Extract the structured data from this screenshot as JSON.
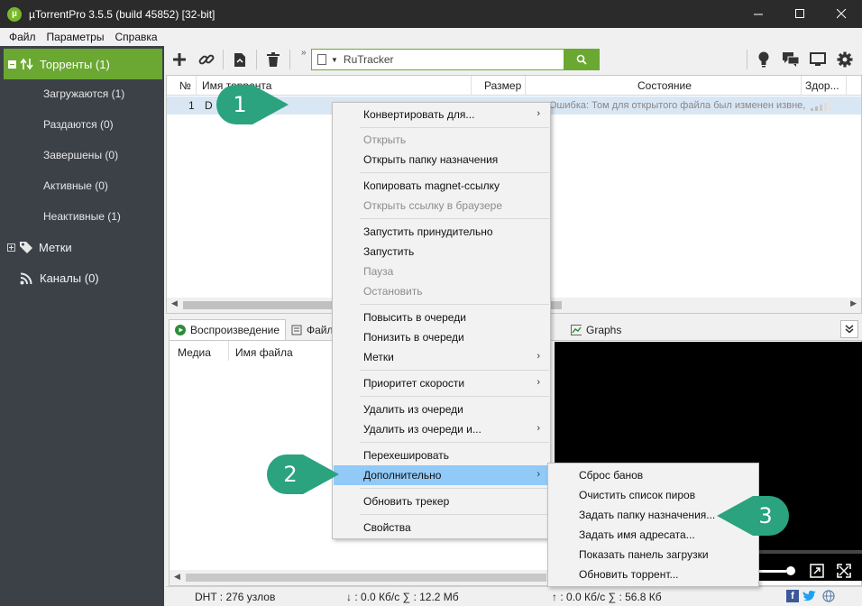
{
  "window": {
    "title": "µTorrentPro 3.5.5  (build 45852) [32-bit]",
    "app_icon_glyph": "µ"
  },
  "menubar": [
    "Файл",
    "Параметры",
    "Справка"
  ],
  "sidebar": {
    "root": "Торренты (1)",
    "items": [
      "Загружаются (1)",
      "Раздаются (0)",
      "Завершены (0)",
      "Активные (0)",
      "Неактивные (1)"
    ],
    "labels": "Метки",
    "feeds": "Каналы (0)"
  },
  "toolbar": {
    "search_value": "RuTracker",
    "icons_left": [
      "add-icon",
      "link-icon",
      "create-icon",
      "delete-icon"
    ],
    "icons_right": [
      "bulb-icon",
      "chat-icon",
      "monitor-icon",
      "gear-icon"
    ]
  },
  "list": {
    "columns": [
      "№",
      "Имя торрента",
      "Размер",
      "Состояние",
      "Здор..."
    ],
    "row": {
      "num": "1",
      "name": "D",
      "status": "Ошибка: Том для открытого файла был изменен извне,"
    }
  },
  "tabs": [
    "Воспроизведение",
    "Файлы",
    "Graphs"
  ],
  "playback": {
    "col_media": "Медиа",
    "col_file": "Имя файла"
  },
  "status": {
    "dht": "DHT : 276 узлов",
    "down": "↓ : 0.0 Кб/с  ∑ : 12.2 Мб",
    "up": "↑ : 0.0 Кб/с  ∑ : 56.8 Кб"
  },
  "context_menu": [
    {
      "label": "Конвертировать для...",
      "submenu": true,
      "disabled": false
    },
    {
      "label": "Открыть",
      "disabled": true
    },
    {
      "label": "Открыть папку назначения",
      "disabled": false
    },
    {
      "label": "Копировать magnet-ссылку",
      "disabled": false
    },
    {
      "label": "Открыть ссылку в браузере",
      "disabled": true
    },
    {
      "label": "Запустить принудительно",
      "disabled": false
    },
    {
      "label": "Запустить",
      "disabled": false
    },
    {
      "label": "Пауза",
      "disabled": true
    },
    {
      "label": "Остановить",
      "disabled": true
    },
    {
      "label": "Повысить в очереди",
      "disabled": false
    },
    {
      "label": "Понизить в очереди",
      "disabled": false
    },
    {
      "label": "Метки",
      "submenu": true,
      "disabled": false
    },
    {
      "label": "Приоритет скорости",
      "submenu": true,
      "disabled": false
    },
    {
      "label": "Удалить из очереди",
      "disabled": false
    },
    {
      "label": "Удалить из очереди и...",
      "submenu": true,
      "disabled": false
    },
    {
      "label": "Перехешировать",
      "disabled": false
    },
    {
      "label": "Дополнительно",
      "submenu": true,
      "disabled": false,
      "highlighted": true
    },
    {
      "label": "Обновить трекер",
      "disabled": false
    },
    {
      "label": "Свойства",
      "disabled": false
    }
  ],
  "submenu": [
    "Сброс банов",
    "Очистить список пиров",
    "Задать папку назначения...",
    "Задать имя адресата...",
    "Показать панель загрузки",
    "Обновить торрент..."
  ],
  "callouts": [
    "1",
    "2",
    "3"
  ],
  "colors": {
    "accent": "#6aa832",
    "callout": "#2aa37e",
    "sidebar": "#3c4148",
    "menu_hover": "#91c9f7"
  }
}
